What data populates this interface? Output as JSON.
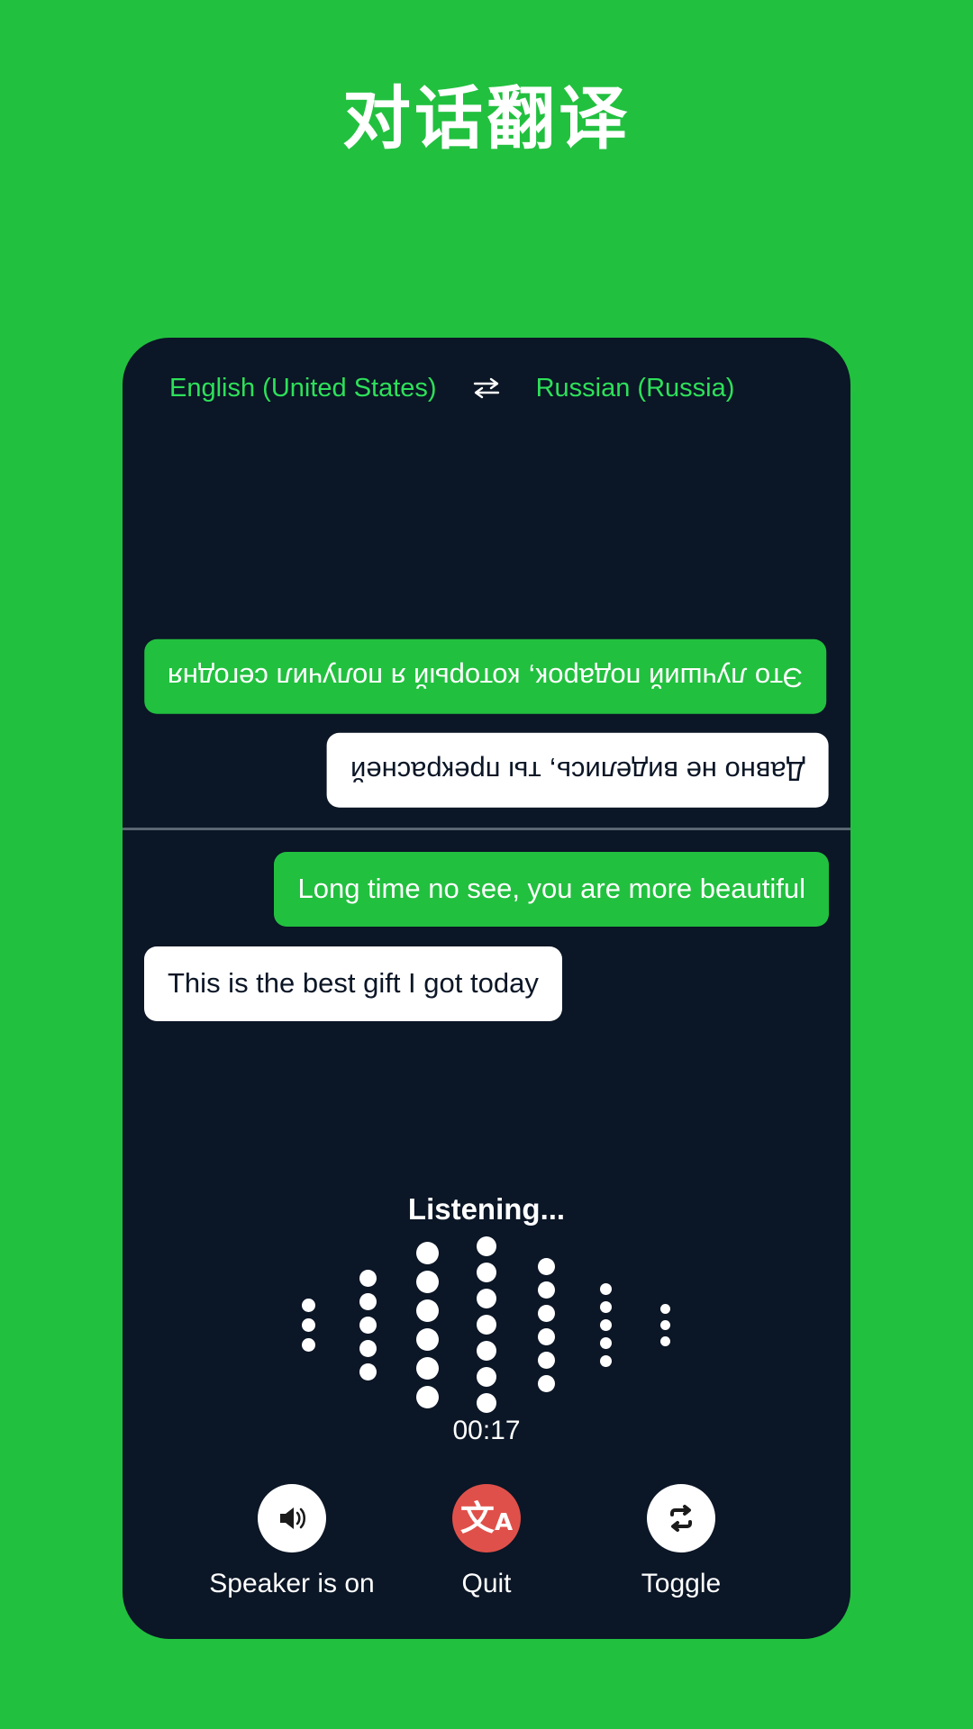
{
  "page": {
    "title": "对话翻译",
    "background_color": "#22c03f",
    "accent_color": "#22c03f",
    "panel_color": "#0b1626"
  },
  "language_bar": {
    "source_language": "English (United States)",
    "target_language": "Russian (Russia)",
    "swap_icon": "swap-horizontal-icon",
    "text_color": "#2ee05a"
  },
  "conversation": {
    "top_pane": {
      "messages": [
        {
          "text": "Это лучший подарок, который я получил сегодня",
          "style": "green",
          "align": "left",
          "rotated": true
        },
        {
          "text": "Давно не виделись, ты прекрасней",
          "style": "white",
          "align": "right",
          "rotated": true
        }
      ]
    },
    "bottom_pane": {
      "messages": [
        {
          "text": "Long time no see, you are more beautiful",
          "style": "green",
          "align": "right",
          "rotated": false
        },
        {
          "text": "This is the best gift I got today",
          "style": "white",
          "align": "left",
          "rotated": false
        }
      ]
    }
  },
  "mic_section": {
    "status_label": "Listening...",
    "timer": "00:17",
    "waveform": {
      "columns": [
        {
          "dots": 3,
          "size": 15
        },
        {
          "dots": 5,
          "size": 19
        },
        {
          "dots": 6,
          "size": 25
        },
        {
          "dots": 7,
          "size": 22
        },
        {
          "dots": 6,
          "size": 19
        },
        {
          "dots": 5,
          "size": 13
        },
        {
          "dots": 3,
          "size": 11
        }
      ]
    }
  },
  "controls": [
    {
      "id": "speaker",
      "label": "Speaker is on",
      "icon": "speaker-on-icon",
      "circle_color": "#ffffff"
    },
    {
      "id": "quit",
      "label": "Quit",
      "icon": "translate-icon",
      "circle_color": "#e0504a"
    },
    {
      "id": "toggle",
      "label": "Toggle",
      "icon": "swap-loop-icon",
      "circle_color": "#ffffff"
    }
  ]
}
